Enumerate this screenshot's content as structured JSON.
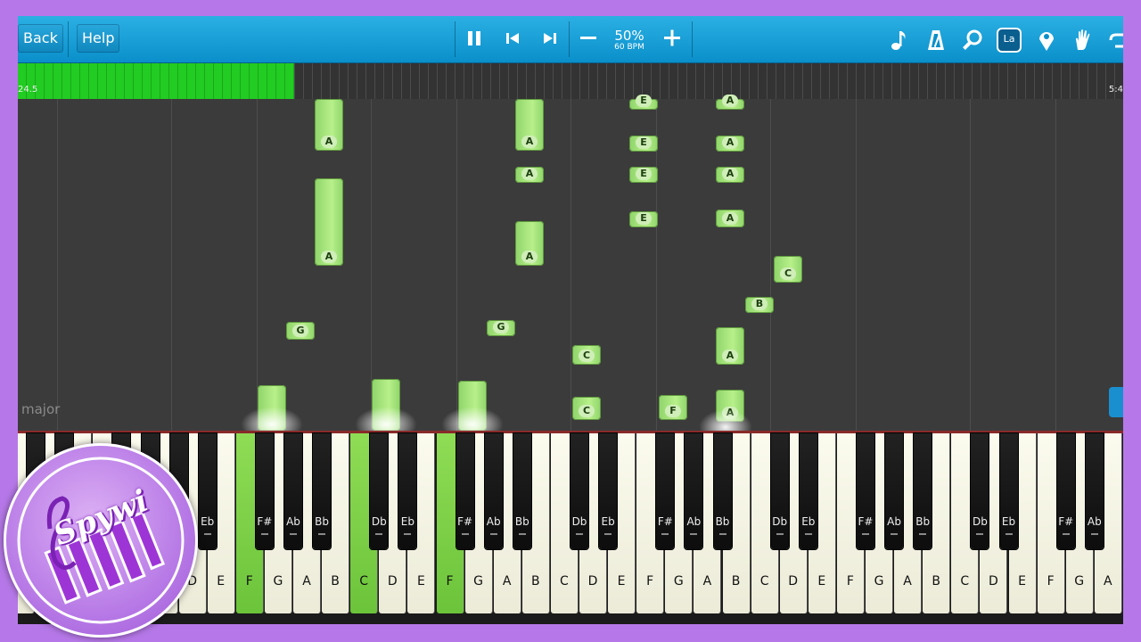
{
  "toolbar": {
    "back_label": "Back",
    "help_label": "Help",
    "tempo_percent": "50%",
    "tempo_bpm": "60 BPM",
    "mode_badge": "La"
  },
  "timeline": {
    "start_time": "24.5",
    "end_time": "5:4",
    "progress_fraction": 0.25
  },
  "status": {
    "key_signature": "major"
  },
  "notes": [
    {
      "label": "A"
    },
    {
      "label": "A"
    },
    {
      "label": "A"
    },
    {
      "label": "A"
    },
    {
      "label": "A"
    },
    {
      "label": "E"
    },
    {
      "label": "E"
    },
    {
      "label": "E"
    },
    {
      "label": "E"
    },
    {
      "label": "A"
    },
    {
      "label": "A"
    },
    {
      "label": "A"
    },
    {
      "label": "A"
    },
    {
      "label": "C"
    },
    {
      "label": "B"
    },
    {
      "label": "G"
    },
    {
      "label": "G"
    },
    {
      "label": "C"
    },
    {
      "label": "C"
    },
    {
      "label": "F"
    },
    {
      "label": "A"
    },
    {
      "label": "A"
    },
    {
      "label": ""
    },
    {
      "label": ""
    },
    {
      "label": ""
    }
  ],
  "keyboard": {
    "white_keys": [
      {
        "label": ""
      },
      {
        "label": ""
      },
      {
        "label": ""
      },
      {
        "label": ""
      },
      {
        "label": ""
      },
      {
        "label": ""
      },
      {
        "label": "D"
      },
      {
        "label": "E"
      },
      {
        "label": "F",
        "active": true
      },
      {
        "label": "G"
      },
      {
        "label": "A"
      },
      {
        "label": "B"
      },
      {
        "label": "C",
        "active": true
      },
      {
        "label": "D"
      },
      {
        "label": "E"
      },
      {
        "label": "F",
        "active": true
      },
      {
        "label": "G"
      },
      {
        "label": "A"
      },
      {
        "label": "B"
      },
      {
        "label": "C"
      },
      {
        "label": "D"
      },
      {
        "label": "E"
      },
      {
        "label": "F"
      },
      {
        "label": "G"
      },
      {
        "label": "A"
      },
      {
        "label": "B"
      },
      {
        "label": "C"
      },
      {
        "label": "D"
      },
      {
        "label": "E"
      },
      {
        "label": "F"
      },
      {
        "label": "G"
      },
      {
        "label": "A"
      },
      {
        "label": "B"
      },
      {
        "label": "C"
      },
      {
        "label": "D"
      },
      {
        "label": "E"
      },
      {
        "label": "F"
      },
      {
        "label": "G"
      },
      {
        "label": "A"
      }
    ],
    "black_keys": [
      {
        "label": ""
      },
      {
        "label": ""
      },
      {
        "label": ""
      },
      {
        "label": ""
      },
      {
        "label": "Db"
      },
      {
        "label": "Eb"
      },
      {
        "label": "F#"
      },
      {
        "label": "Ab"
      },
      {
        "label": "Bb"
      },
      {
        "label": "Db"
      },
      {
        "label": "Eb"
      },
      {
        "label": "F#"
      },
      {
        "label": "Ab"
      },
      {
        "label": "Bb"
      },
      {
        "label": "Db"
      },
      {
        "label": "Eb"
      },
      {
        "label": "F#"
      },
      {
        "label": "Ab"
      },
      {
        "label": "Bb"
      },
      {
        "label": "Db"
      },
      {
        "label": "Eb"
      },
      {
        "label": "F#"
      },
      {
        "label": "Ab"
      },
      {
        "label": "Bb"
      },
      {
        "label": "Db"
      },
      {
        "label": "Eb"
      },
      {
        "label": "F#"
      },
      {
        "label": "Ab"
      }
    ]
  },
  "logo": {
    "text": "Spywi"
  },
  "colors": {
    "toolbar": "#0a8fca",
    "note": "#a6e47a",
    "active_key": "#7ccf45",
    "frame": "#b678e8"
  }
}
